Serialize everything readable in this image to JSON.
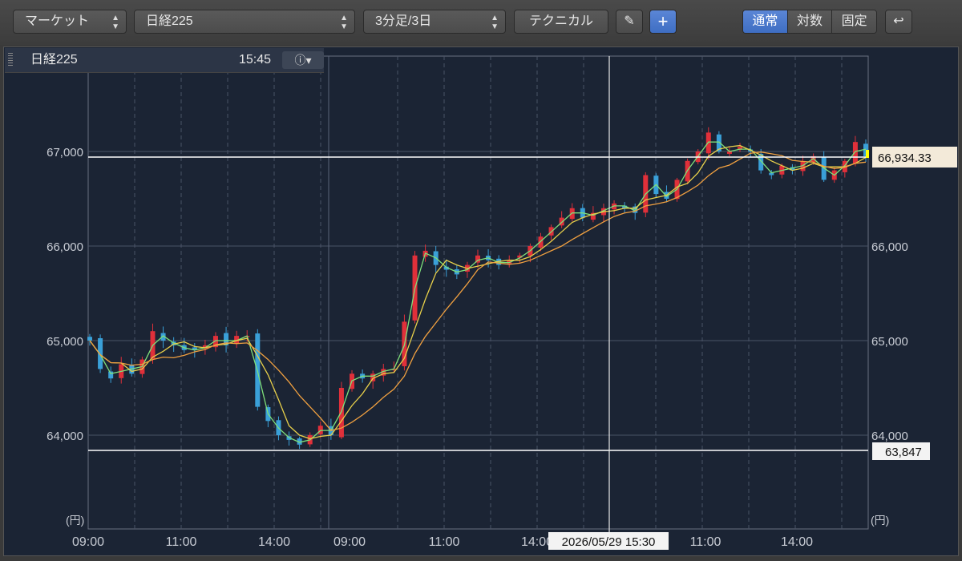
{
  "toolbar": {
    "market_select": "マーケット",
    "symbol_select": "日経225",
    "interval_select": "3分足/3日",
    "technical_button": "テクニカル",
    "pen_icon": "pencil-icon",
    "crosshair_icon": "plus-icon",
    "scale_modes": [
      "通常",
      "対数",
      "固定"
    ],
    "active_scale": "通常",
    "undo_icon": "undo-arrow-icon"
  },
  "infobar": {
    "symbol": "日経225",
    "time": "15:45",
    "info_icon": "info-icon"
  },
  "chart_data": {
    "type": "candlestick",
    "y_unit": "(円)",
    "ylim": [
      63000,
      67800
    ],
    "y_ticks": [
      "67,000",
      "66,000",
      "65,000",
      "64,000"
    ],
    "x_ticks": [
      "09:00",
      "11:00",
      "14:00",
      "09:00",
      "11:00",
      "14:00",
      "11:00",
      "14:00"
    ],
    "last_price_label": "66,934.33",
    "low_line_label": "63,847",
    "crosshair_time_label": "2026/05/29 15:30",
    "colors": {
      "up": "#e0303a",
      "down": "#3aa0d8",
      "ma_short": "#7fe07a",
      "ma_mid": "#e8d04a",
      "ma_long": "#f0a040",
      "bg": "#1b2434"
    },
    "close_series": [
      65000,
      64700,
      64600,
      64750,
      64650,
      64800,
      65100,
      65000,
      64950,
      64900,
      64900,
      64950,
      65050,
      64950,
      65050,
      65050,
      64300,
      64150,
      64000,
      63950,
      63900,
      64000,
      64100,
      64000,
      64500,
      64650,
      64600,
      64650,
      64700,
      64700,
      65200,
      65900,
      65950,
      65800,
      65750,
      65700,
      65800,
      65900,
      65850,
      65800,
      65850,
      65900,
      66000,
      66100,
      66200,
      66300,
      66400,
      66300,
      66350,
      66400,
      66450,
      66400,
      66350,
      66750,
      66550,
      66500,
      66700,
      66900,
      67000,
      67200,
      67000,
      67000,
      67050,
      67000,
      66800,
      66750,
      66850,
      66800,
      66900,
      66950,
      66700,
      66800,
      66900,
      67100,
      66950
    ]
  }
}
